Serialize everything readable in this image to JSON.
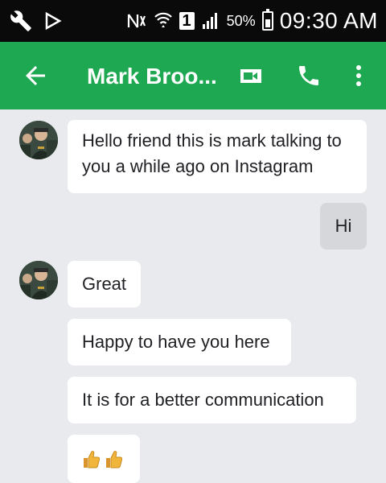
{
  "status_bar": {
    "sim_slot": "1",
    "battery_percent": "50%",
    "time": "09:30 AM"
  },
  "app_bar": {
    "title": "Mark Broo..."
  },
  "messages": [
    {
      "direction": "incoming",
      "text": "Hello friend this is mark talking to you a while ago on Instagram"
    },
    {
      "direction": "outgoing",
      "text": "Hi"
    },
    {
      "direction": "incoming",
      "text": "Great"
    },
    {
      "direction": "incoming",
      "text": "Happy to have you here"
    },
    {
      "direction": "incoming",
      "text": "It is for a better communication"
    },
    {
      "direction": "incoming",
      "emoji": [
        "thumbs-up",
        "thumbs-up"
      ]
    }
  ],
  "colors": {
    "app_bar": "#1da851",
    "status_bar": "#0a0a0a",
    "background": "#e8eaed",
    "incoming_bubble": "#ffffff",
    "outgoing_bubble": "#d5d7da"
  },
  "icons": [
    "wrench-icon",
    "play-store-icon",
    "nfc-icon",
    "wifi-icon",
    "signal-icon",
    "battery-icon",
    "back-arrow-icon",
    "video-call-icon",
    "phone-icon",
    "more-vert-icon",
    "thumbs-up-icon"
  ]
}
